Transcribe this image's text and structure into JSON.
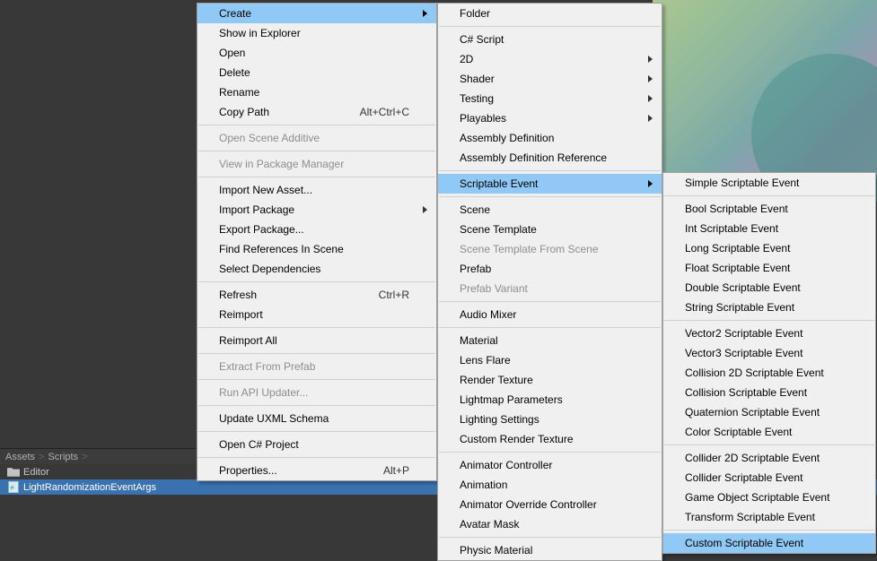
{
  "breadcrumb": {
    "part1": "Assets",
    "part2": "Scripts"
  },
  "project": {
    "folder": "Editor",
    "file": "LightRandomizationEventArgs"
  },
  "menu1": {
    "create": "Create",
    "show_in_explorer": "Show in Explorer",
    "open": "Open",
    "delete": "Delete",
    "rename": "Rename",
    "copy_path": "Copy Path",
    "copy_path_sc": "Alt+Ctrl+C",
    "open_scene_additive": "Open Scene Additive",
    "view_in_pkg": "View in Package Manager",
    "import_new_asset": "Import New Asset...",
    "import_package": "Import Package",
    "export_package": "Export Package...",
    "find_refs": "Find References In Scene",
    "select_deps": "Select Dependencies",
    "refresh": "Refresh",
    "refresh_sc": "Ctrl+R",
    "reimport": "Reimport",
    "reimport_all": "Reimport All",
    "extract_prefab": "Extract From Prefab",
    "run_api": "Run API Updater...",
    "update_uxml": "Update UXML Schema",
    "open_cs_project": "Open C# Project",
    "properties": "Properties...",
    "properties_sc": "Alt+P"
  },
  "menu2": {
    "folder": "Folder",
    "cs_script": "C# Script",
    "two_d": "2D",
    "shader": "Shader",
    "testing": "Testing",
    "playables": "Playables",
    "asm_def": "Assembly Definition",
    "asm_def_ref": "Assembly Definition Reference",
    "scriptable_event": "Scriptable Event",
    "scene": "Scene",
    "scene_template": "Scene Template",
    "scene_template_from": "Scene Template From Scene",
    "prefab": "Prefab",
    "prefab_variant": "Prefab Variant",
    "audio_mixer": "Audio Mixer",
    "material": "Material",
    "lens_flare": "Lens Flare",
    "render_texture": "Render Texture",
    "lightmap_params": "Lightmap Parameters",
    "lighting_settings": "Lighting Settings",
    "custom_render_texture": "Custom Render Texture",
    "animator_controller": "Animator Controller",
    "animation": "Animation",
    "animator_override": "Animator Override Controller",
    "avatar_mask": "Avatar Mask",
    "physic_material": "Physic Material"
  },
  "menu3": {
    "simple": "Simple Scriptable Event",
    "bool": "Bool Scriptable Event",
    "int": "Int Scriptable Event",
    "long": "Long Scriptable Event",
    "float": "Float Scriptable Event",
    "double": "Double Scriptable Event",
    "string": "String Scriptable Event",
    "vector2": "Vector2 Scriptable Event",
    "vector3": "Vector3 Scriptable Event",
    "collision2d": "Collision 2D Scriptable Event",
    "collision": "Collision Scriptable Event",
    "quaternion": "Quaternion Scriptable Event",
    "color": "Color Scriptable Event",
    "collider2d": "Collider 2D Scriptable Event",
    "collider": "Collider Scriptable Event",
    "game_object": "Game Object Scriptable Event",
    "transform": "Transform Scriptable Event",
    "custom": "Custom Scriptable Event"
  }
}
